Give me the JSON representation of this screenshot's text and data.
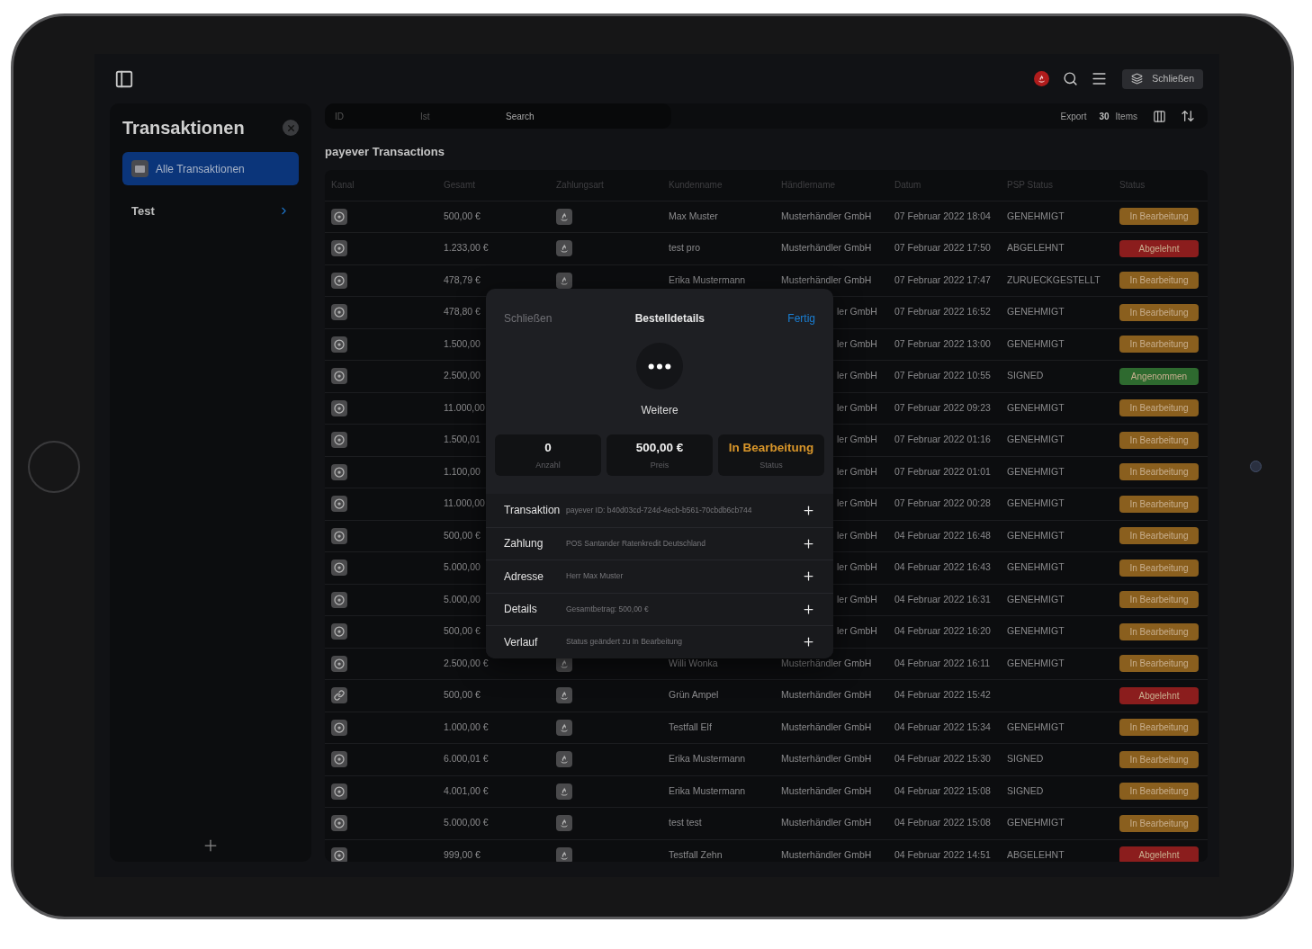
{
  "topbar": {
    "button": "Schließen"
  },
  "sidebar": {
    "title": "Transaktionen",
    "items": [
      {
        "label": "Alle Transaktionen",
        "selected": true
      },
      {
        "label": "Test",
        "selected": false
      }
    ]
  },
  "toolbar": {
    "filters": [
      "ID",
      "Ist"
    ],
    "search": {
      "placeholder": "Search"
    },
    "export": "Export",
    "count": "30",
    "count_label": "Items"
  },
  "heading": "payever Transactions",
  "table": {
    "columns": [
      "Kanal",
      "Gesamt",
      "Zahlungsart",
      "Kundenname",
      "Händlername",
      "Datum",
      "PSP Status",
      "Status"
    ],
    "rows": [
      {
        "kind": "pos",
        "total": "500,00 €",
        "customer": "Max Muster",
        "merchant": "Musterhändler GmbH",
        "date": "07 Februar 2022 18:04",
        "psp": "GENEHMIGT",
        "status": {
          "label": "In Bearbeitung",
          "color": "#8a5f1e"
        }
      },
      {
        "kind": "pos",
        "total": "1.233,00 €",
        "customer": "test pro",
        "merchant": "Musterhändler GmbH",
        "date": "07 Februar 2022 17:50",
        "psp": "ABGELEHNT",
        "status": {
          "label": "Abgelehnt",
          "color": "#8b1d1d"
        }
      },
      {
        "kind": "pos",
        "total": "478,79 €",
        "customer": "Erika Mustermann",
        "merchant": "Musterhändler GmbH",
        "date": "07 Februar 2022 17:47",
        "psp": "ZURUECKGESTELLT",
        "status": {
          "label": "In Bearbeitung",
          "color": "#8a5f1e"
        }
      },
      {
        "kind": "pos",
        "total": "478,80 €",
        "merchant": "ler GmbH",
        "date": "07 Februar 2022 16:52",
        "psp": "GENEHMIGT",
        "status": {
          "label": "In Bearbeitung",
          "color": "#8a5f1e"
        }
      },
      {
        "kind": "pos",
        "total": "1.500,00",
        "merchant": "ler GmbH",
        "date": "07 Februar 2022 13:00",
        "psp": "GENEHMIGT",
        "status": {
          "label": "In Bearbeitung",
          "color": "#8a5f1e"
        }
      },
      {
        "kind": "pos",
        "total": "2.500,00",
        "merchant": "ler GmbH",
        "date": "07 Februar 2022 10:55",
        "psp": "SIGNED",
        "status": {
          "label": "Angenommen",
          "color": "#2e6a2f"
        }
      },
      {
        "kind": "pos",
        "total": "11.000,00",
        "merchant": "ler GmbH",
        "date": "07 Februar 2022 09:23",
        "psp": "GENEHMIGT",
        "status": {
          "label": "In Bearbeitung",
          "color": "#8a5f1e"
        }
      },
      {
        "kind": "pos",
        "total": "1.500,01",
        "merchant": "ler GmbH",
        "date": "07 Februar 2022 01:16",
        "psp": "GENEHMIGT",
        "status": {
          "label": "In Bearbeitung",
          "color": "#8a5f1e"
        }
      },
      {
        "kind": "pos",
        "total": "1.100,00",
        "merchant": "ler GmbH",
        "date": "07 Februar 2022 01:01",
        "psp": "GENEHMIGT",
        "status": {
          "label": "In Bearbeitung",
          "color": "#8a5f1e"
        }
      },
      {
        "kind": "pos",
        "total": "11.000,00",
        "merchant": "ler GmbH",
        "date": "07 Februar 2022 00:28",
        "psp": "GENEHMIGT",
        "status": {
          "label": "In Bearbeitung",
          "color": "#8a5f1e"
        }
      },
      {
        "kind": "pos",
        "total": "500,00 €",
        "merchant": "ler GmbH",
        "date": "04 Februar 2022 16:48",
        "psp": "GENEHMIGT",
        "status": {
          "label": "In Bearbeitung",
          "color": "#8a5f1e"
        }
      },
      {
        "kind": "pos",
        "total": "5.000,00",
        "merchant": "ler GmbH",
        "date": "04 Februar 2022 16:43",
        "psp": "GENEHMIGT",
        "status": {
          "label": "In Bearbeitung",
          "color": "#8a5f1e"
        }
      },
      {
        "kind": "pos",
        "total": "5.000,00",
        "merchant": "ler GmbH",
        "date": "04 Februar 2022 16:31",
        "psp": "GENEHMIGT",
        "status": {
          "label": "In Bearbeitung",
          "color": "#8a5f1e"
        }
      },
      {
        "kind": "pos",
        "total": "500,00 €",
        "merchant": "ler GmbH",
        "date": "04 Februar 2022 16:20",
        "psp": "GENEHMIGT",
        "status": {
          "label": "In Bearbeitung",
          "color": "#8a5f1e"
        }
      },
      {
        "kind": "pos",
        "total": "2.500,00 €",
        "customer": "Willi Wonka",
        "merchant": "Musterhändler GmbH",
        "date": "04 Februar 2022 16:11",
        "psp": "GENEHMIGT",
        "status": {
          "label": "In Bearbeitung",
          "color": "#8a5f1e"
        }
      },
      {
        "kind": "link",
        "total": "500,00 €",
        "customer": "Grün Ampel",
        "merchant": "Musterhändler GmbH",
        "date": "04 Februar 2022 15:42",
        "status": {
          "label": "Abgelehnt",
          "color": "#8b1d1d"
        }
      },
      {
        "kind": "pos",
        "total": "1.000,00 €",
        "customer": "Testfall Elf",
        "merchant": "Musterhändler GmbH",
        "date": "04 Februar 2022 15:34",
        "psp": "GENEHMIGT",
        "status": {
          "label": "In Bearbeitung",
          "color": "#8a5f1e"
        }
      },
      {
        "kind": "pos",
        "total": "6.000,01 €",
        "customer": "Erika Mustermann",
        "merchant": "Musterhändler GmbH",
        "date": "04 Februar 2022 15:30",
        "psp": "SIGNED",
        "status": {
          "label": "In Bearbeitung",
          "color": "#8a5f1e"
        }
      },
      {
        "kind": "pos",
        "total": "4.001,00 €",
        "customer": "Erika Mustermann",
        "merchant": "Musterhändler GmbH",
        "date": "04 Februar 2022 15:08",
        "psp": "SIGNED",
        "status": {
          "label": "In Bearbeitung",
          "color": "#8a5f1e"
        }
      },
      {
        "kind": "pos",
        "total": "5.000,00 €",
        "customer": "test test",
        "merchant": "Musterhändler GmbH",
        "date": "04 Februar 2022 15:08",
        "psp": "GENEHMIGT",
        "status": {
          "label": "In Bearbeitung",
          "color": "#8a5f1e"
        }
      },
      {
        "kind": "pos",
        "total": "999,00 €",
        "customer": "Testfall Zehn",
        "merchant": "Musterhändler GmbH",
        "date": "04 Februar 2022 14:51",
        "psp": "ABGELEHNT",
        "status": {
          "label": "Abgelehnt",
          "color": "#8b1d1d"
        }
      }
    ]
  },
  "modal": {
    "close": "Schließen",
    "title": "Bestelldetails",
    "done": "Fertig",
    "more": "Weitere",
    "stats": [
      {
        "value": "0",
        "label": "Anzahl",
        "kind": "plain"
      },
      {
        "value": "500,00 €",
        "label": "Preis",
        "kind": "plain"
      },
      {
        "value": "In Bearbeitung",
        "label": "Status",
        "kind": "status"
      }
    ],
    "sections": [
      {
        "label": "Transaktion",
        "value": "payever ID: b40d03cd-724d-4ecb-b561-70cbdb6cb744",
        "expanded": false
      },
      {
        "label": "Zahlung",
        "value": "POS Santander Ratenkredit Deutschland",
        "expanded": false
      },
      {
        "label": "Adresse",
        "value": "Herr Max Muster",
        "expanded": false
      },
      {
        "label": "Details",
        "value": "Gesamtbetrag: 500,00 €",
        "expanded": false
      },
      {
        "label": "Verlauf",
        "value": "Status geändert zu In Bearbeitung",
        "expanded": false
      }
    ]
  }
}
